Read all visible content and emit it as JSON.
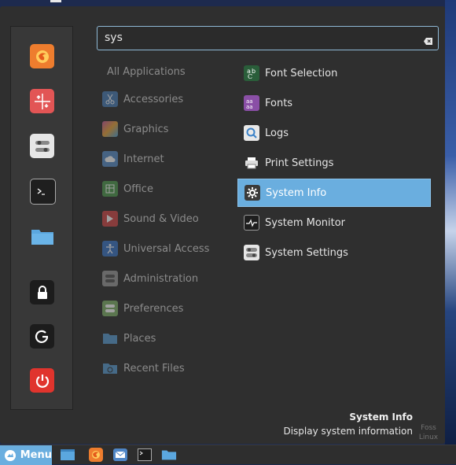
{
  "search": {
    "value": "sys"
  },
  "categories": [
    {
      "label": "All Applications",
      "icon": "none"
    },
    {
      "label": "Accessories",
      "icon": "scissors-icon",
      "color": "#4a7db5"
    },
    {
      "label": "Graphics",
      "icon": "palette-icon",
      "color": "#c85a9a"
    },
    {
      "label": "Internet",
      "icon": "cloud-icon",
      "color": "#5a8fc9"
    },
    {
      "label": "Office",
      "icon": "spreadsheet-icon",
      "color": "#4f9a4f"
    },
    {
      "label": "Sound & Video",
      "icon": "play-icon",
      "color": "#d04848"
    },
    {
      "label": "Universal Access",
      "icon": "accessibility-icon",
      "color": "#3a74c4"
    },
    {
      "label": "Administration",
      "icon": "toggles-icon",
      "color": "#9a9a9a"
    },
    {
      "label": "Preferences",
      "icon": "toggles-icon",
      "color": "#7fb06a"
    },
    {
      "label": "Places",
      "icon": "folder-icon",
      "color": "#5a9bd0"
    },
    {
      "label": "Recent Files",
      "icon": "folder-icon",
      "color": "#5a9bd0"
    }
  ],
  "apps": [
    {
      "label": "Font Selection",
      "icon": "font-selection-icon"
    },
    {
      "label": "Fonts",
      "icon": "fonts-icon"
    },
    {
      "label": "Logs",
      "icon": "logs-icon"
    },
    {
      "label": "Print Settings",
      "icon": "printer-icon"
    },
    {
      "label": "System Info",
      "icon": "gear-icon",
      "selected": true
    },
    {
      "label": "System Monitor",
      "icon": "system-monitor-icon"
    },
    {
      "label": "System Settings",
      "icon": "toggles-icon"
    }
  ],
  "info": {
    "title": "System Info",
    "description": "Display system information"
  },
  "favorites": [
    "firefox-icon",
    "software-manager-icon",
    "settings-toggles-icon",
    "terminal-icon",
    "files-folder-icon",
    "lock-icon",
    "logout-icon",
    "power-icon"
  ],
  "taskbar": {
    "menu_label": "Menu",
    "launchers": [
      "show-desktop-icon",
      "firefox-icon",
      "mail-icon",
      "terminal-icon",
      "folder-icon"
    ]
  },
  "watermark": {
    "line1": "Foss",
    "line2": "Linux"
  },
  "colors": {
    "accent": "#6aaedf",
    "panel": "#2f2f2f"
  }
}
